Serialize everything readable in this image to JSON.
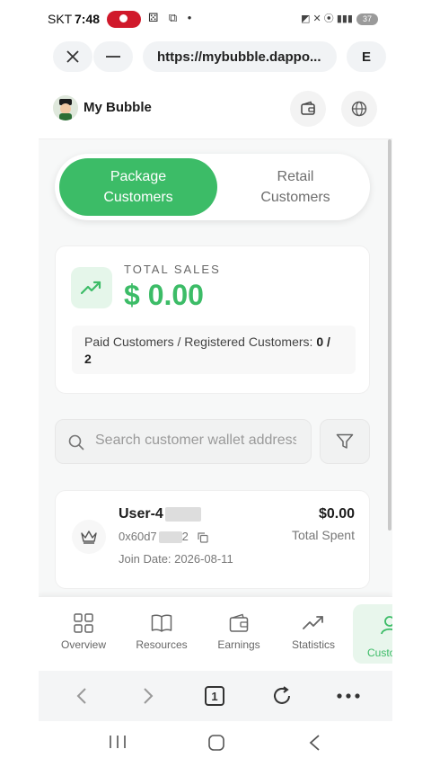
{
  "status_bar": {
    "carrier": "SKT",
    "time": "7:48",
    "battery": "37"
  },
  "browser": {
    "close_icon": "close-icon",
    "minimize_icon": "minus-icon",
    "url": "https://mybubble.dappo...",
    "profile_letter": "E"
  },
  "header": {
    "title": "My Bubble",
    "wallet_icon": "wallet-icon",
    "globe_icon": "globe-icon"
  },
  "segmented": {
    "package_line1": "Package",
    "package_line2": "Customers",
    "retail_line1": "Retail",
    "retail_line2": "Customers",
    "active": "Package Customers"
  },
  "sales": {
    "label": "TOTAL SALES",
    "value": "$ 0.00",
    "paid_text": "Paid Customers / Registered Customers:",
    "paid_value_a": "0 /",
    "paid_value_b": "2"
  },
  "search": {
    "placeholder": "Search customer wallet address"
  },
  "customer": {
    "name": "User-4",
    "address": "0x60d7",
    "address_end": "2",
    "join_date": "Join Date: 2026-08-11",
    "amount": "$0.00",
    "amount_label": "Total Spent"
  },
  "bottom_nav": {
    "overview": "Overview",
    "resources": "Resources",
    "earnings": "Earnings",
    "statistics": "Statistics",
    "customers": "Custo"
  },
  "browser_toolbar": {
    "tab_count": "1"
  },
  "colors": {
    "accent": "#3cbc67",
    "accent_light": "#e5f6ea"
  }
}
